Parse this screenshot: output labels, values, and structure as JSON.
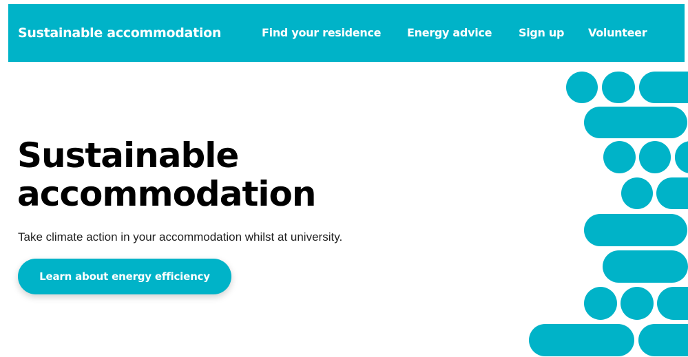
{
  "nav": {
    "brand": "Sustainable accommodation",
    "links": [
      "Find your residence",
      "Energy advice",
      "Sign up",
      "Volunteer"
    ]
  },
  "hero": {
    "title_line1": "Sustainable",
    "title_line2": "accommodation",
    "subtitle": "Take climate action in your accommodation whilst at university.",
    "cta_label": "Learn about energy efficiency"
  },
  "colors": {
    "accent": "#00b3c8",
    "text": "#000000"
  }
}
